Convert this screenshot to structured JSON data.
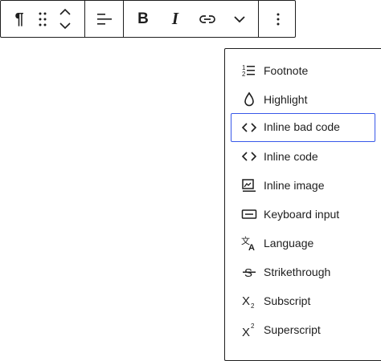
{
  "toolbar": {
    "paragraph_icon_glyph": "¶",
    "bold_label": "B",
    "italic_label": "I",
    "icons": [
      "pilcrow-icon",
      "drag-handle-icon",
      "chevron-up-icon",
      "chevron-down-icon",
      "align-left-icon",
      "link-icon",
      "more-rich-text-icon",
      "options-icon"
    ]
  },
  "menu": {
    "items": [
      {
        "label": "Footnote",
        "icon": "footnote-icon"
      },
      {
        "label": "Highlight",
        "icon": "highlight-icon"
      },
      {
        "label": "Inline bad code",
        "icon": "code-icon"
      },
      {
        "label": "Inline code",
        "icon": "code-icon"
      },
      {
        "label": "Inline image",
        "icon": "image-icon"
      },
      {
        "label": "Keyboard input",
        "icon": "keyboard-icon"
      },
      {
        "label": "Language",
        "icon": "language-icon"
      },
      {
        "label": "Strikethrough",
        "icon": "strikethrough-icon"
      },
      {
        "label": "Subscript",
        "icon": "subscript-icon"
      },
      {
        "label": "Superscript",
        "icon": "superscript-icon"
      }
    ],
    "focused_index": 2
  },
  "colors": {
    "text": "#1e1e1e",
    "focus": "#3858e9",
    "background": "#ffffff"
  }
}
